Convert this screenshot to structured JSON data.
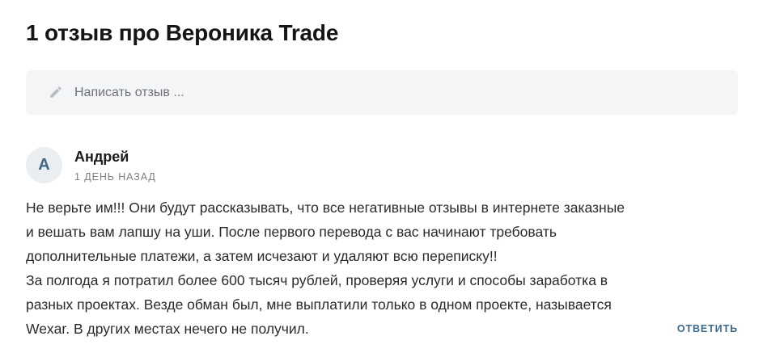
{
  "page": {
    "title": "1 отзыв про Вероника Trade"
  },
  "write_review": {
    "placeholder": "Написать отзыв ..."
  },
  "reviews": [
    {
      "avatar_letter": "А",
      "author": "Андрей",
      "date": "1 ДЕНЬ НАЗАД",
      "lines": [
        "Не верьте им!!! Они будут рассказывать, что все негативные отзывы в интернете заказные",
        "и вешать вам лапшу на уши. После первого перевода с вас начинают требовать",
        "дополнительные платежи, а затем исчезают и удаляют всю переписку!!",
        "За полгода я потратил более 600 тысяч рублей, проверяя услуги и способы заработка в",
        "разных проектах. Везде обман был, мне выплатили только в одном проекте, называется",
        "Wexar. В других местах нечего не получил."
      ],
      "reply_label": "ОТВЕТИТЬ"
    }
  ],
  "colors": {
    "accent": "#3d6a89",
    "input_bg": "#f4f5f6",
    "avatar_bg": "#eaeef1"
  },
  "icons": {
    "write": "pencil-icon"
  }
}
